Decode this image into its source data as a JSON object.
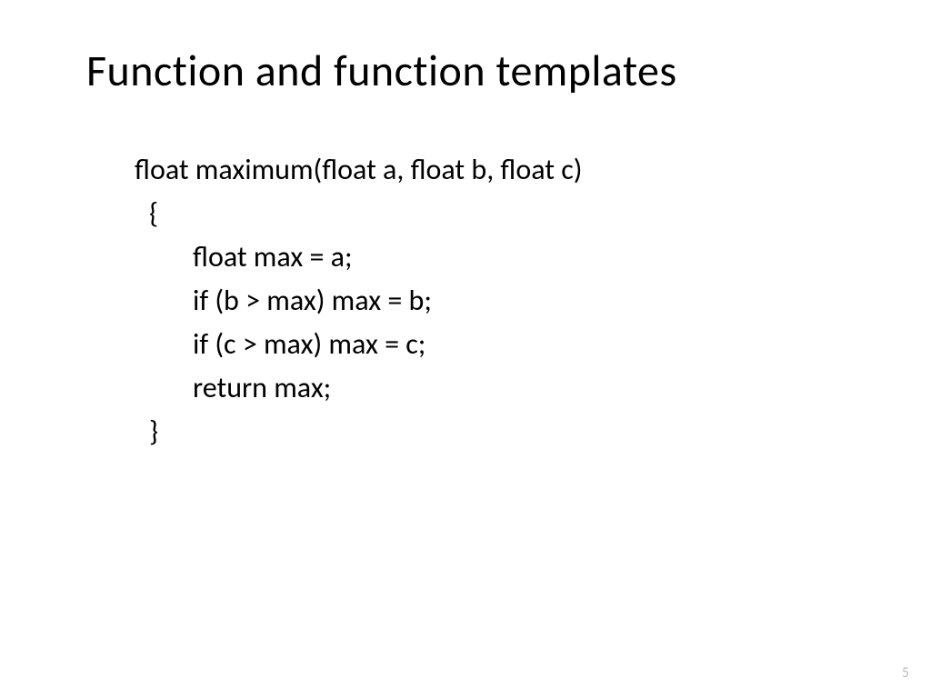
{
  "slide": {
    "title": "Function and function templates",
    "code": {
      "line1": "float maximum(float a, float b, float c)",
      "line2": "{",
      "line3": "float max = a;",
      "line4": "if (b > max) max = b;",
      "line5": "if (c > max) max = c;",
      "line6": "return max;",
      "line7": "}"
    },
    "pageNumber": "5"
  }
}
